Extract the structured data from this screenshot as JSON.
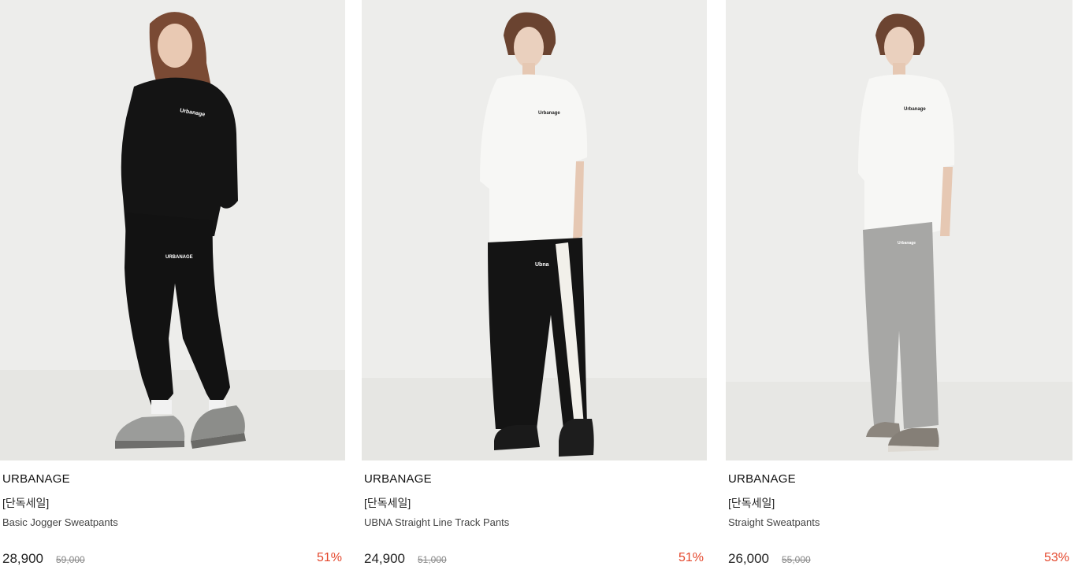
{
  "products": [
    {
      "brand": "URBANAGE",
      "tag": "[단독세일]",
      "name": "Basic Jogger Sweatpants",
      "price": "28,900",
      "original_price": "59,000",
      "discount": "51%",
      "image_alt": "model in black sweatshirt and black jogger sweatpants"
    },
    {
      "brand": "URBANAGE",
      "tag": "[단독세일]",
      "name": "UBNA Straight Line Track Pants",
      "price": "24,900",
      "original_price": "51,000",
      "discount": "51%",
      "image_alt": "model in white t-shirt and black track pants with white side stripe"
    },
    {
      "brand": "URBANAGE",
      "tag": "[단독세일]",
      "name": "Straight Sweatpants",
      "price": "26,000",
      "original_price": "55,000",
      "discount": "53%",
      "image_alt": "model in white t-shirt and grey straight sweatpants"
    }
  ],
  "colors": {
    "discount": "#e4472c",
    "photo_background": "#ececea"
  }
}
